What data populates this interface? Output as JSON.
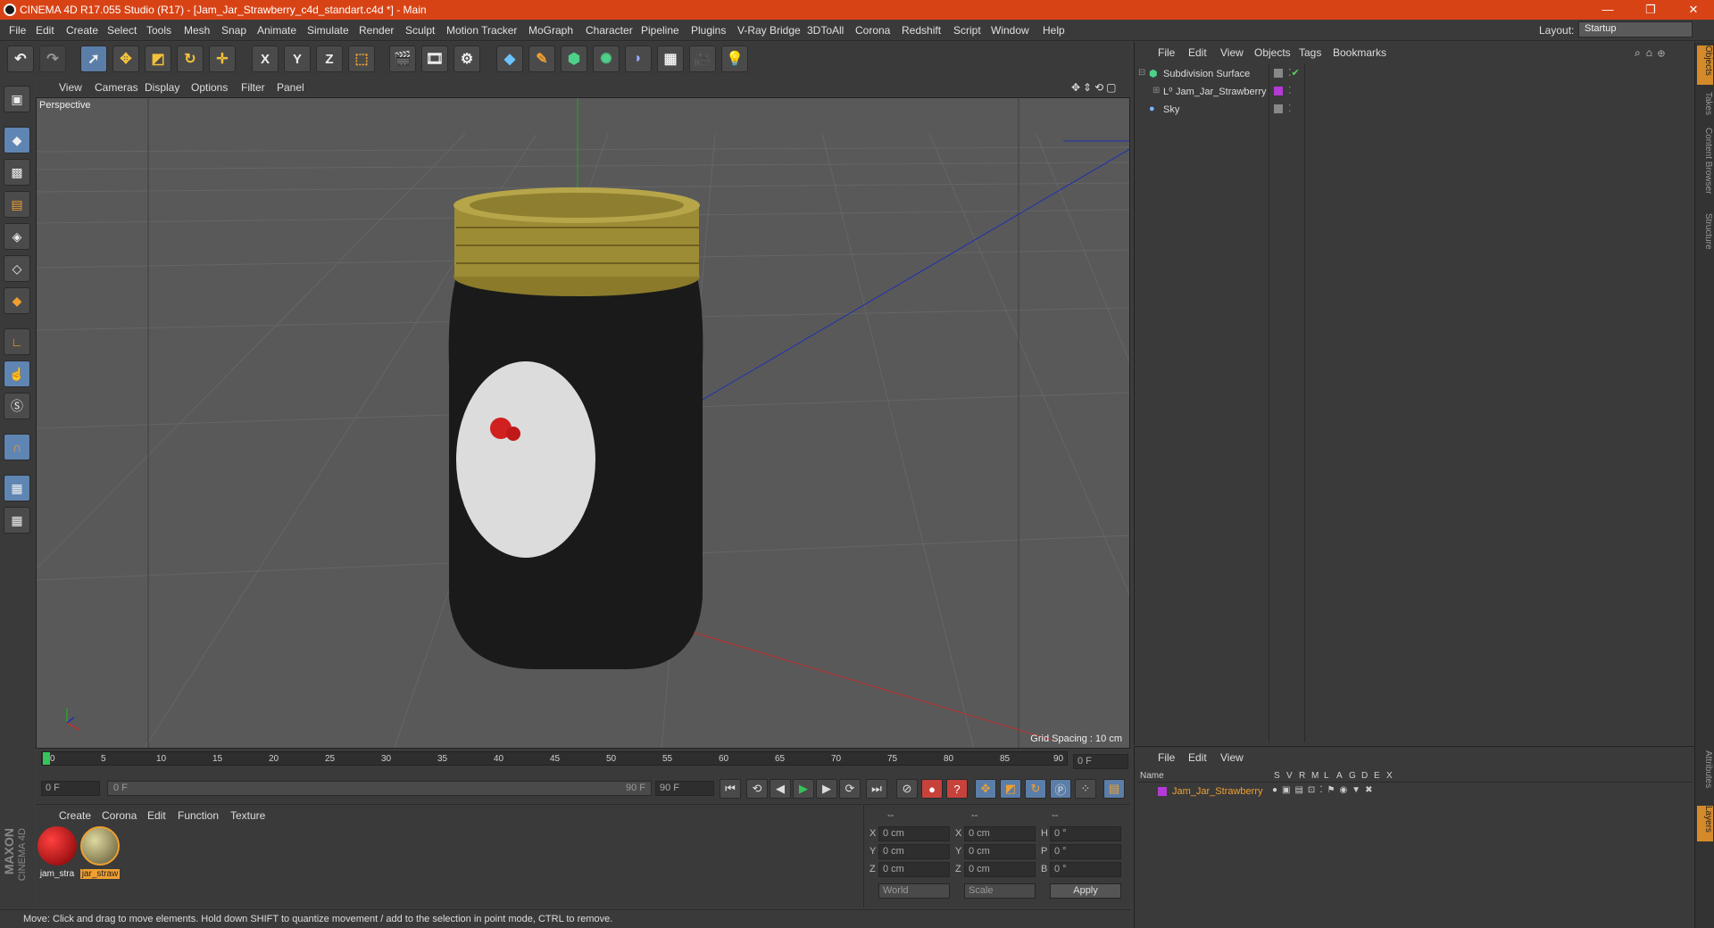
{
  "title": "CINEMA 4D R17.055 Studio (R17) - [Jam_Jar_Strawberry_c4d_standart.c4d *] - Main",
  "window_controls": [
    "—",
    "❐",
    "✕"
  ],
  "menu": [
    "File",
    "Edit",
    "Create",
    "Select",
    "Tools",
    "Mesh",
    "Snap",
    "Animate",
    "Simulate",
    "Render",
    "Sculpt",
    "Motion Tracker",
    "MoGraph",
    "Character",
    "Pipeline",
    "Plugins",
    "V-Ray Bridge",
    "3DToAll",
    "Corona",
    "Redshift",
    "Script",
    "Window",
    "Help"
  ],
  "layout": {
    "label": "Layout:",
    "value": "Startup"
  },
  "toolbar": {
    "x": "X",
    "y": "Y",
    "z": "Z"
  },
  "viewport": {
    "menu": [
      "View",
      "Cameras",
      "Display",
      "Options",
      "Filter",
      "Panel"
    ],
    "label": "Perspective",
    "grid_spacing": "Grid Spacing : 10 cm"
  },
  "timeline": {
    "ticks": [
      "0",
      "5",
      "10",
      "15",
      "20",
      "25",
      "30",
      "35",
      "40",
      "45",
      "50",
      "55",
      "60",
      "65",
      "70",
      "75",
      "80",
      "85",
      "90"
    ],
    "current": "0 F",
    "start": "0 F",
    "slider_start": "0 F",
    "slider_end": "90 F",
    "end": "90 F"
  },
  "materials": {
    "menu": [
      "Create",
      "Corona",
      "Edit",
      "Function",
      "Texture"
    ],
    "items": [
      {
        "label": "jam_stra",
        "color": "#b01010"
      },
      {
        "label": "jar_straw",
        "color": "#9a9060"
      }
    ]
  },
  "coords": {
    "headers": [
      "--",
      "--",
      "--"
    ],
    "rows": [
      {
        "a": "X",
        "av": "0 cm",
        "b": "X",
        "bv": "0 cm",
        "c": "H",
        "cv": "0 °"
      },
      {
        "a": "Y",
        "av": "0 cm",
        "b": "Y",
        "bv": "0 cm",
        "c": "P",
        "cv": "0 °"
      },
      {
        "a": "Z",
        "av": "0 cm",
        "b": "Z",
        "bv": "0 cm",
        "c": "B",
        "cv": "0 °"
      }
    ],
    "world": "World",
    "scale": "Scale",
    "apply": "Apply"
  },
  "brand": {
    "maxon": "MAXON",
    "product": "CINEMA 4D"
  },
  "status": "Move: Click and drag to move elements. Hold down SHIFT to quantize movement / add to the selection in point mode, CTRL to remove.",
  "objects": {
    "menu": [
      "File",
      "Edit",
      "View",
      "Objects",
      "Tags",
      "Bookmarks"
    ],
    "items": [
      {
        "name": "Subdivision Surface"
      },
      {
        "name": "Jam_Jar_Strawberry"
      },
      {
        "name": "Sky"
      }
    ]
  },
  "layers": {
    "menu": [
      "File",
      "Edit",
      "View"
    ],
    "columns": {
      "name": "Name",
      "flags": [
        "S",
        "V",
        "R",
        "M",
        "L",
        "A",
        "G",
        "D",
        "E",
        "X"
      ]
    },
    "row": "Jam_Jar_Strawberry"
  },
  "side_tabs": [
    "Objects",
    "Takes",
    "Content Browser",
    "Structure",
    "Attributes",
    "Layers"
  ],
  "colors": {
    "accent": "#d84315",
    "selection": "#5b7ea8",
    "layer": "#b33ad6"
  }
}
